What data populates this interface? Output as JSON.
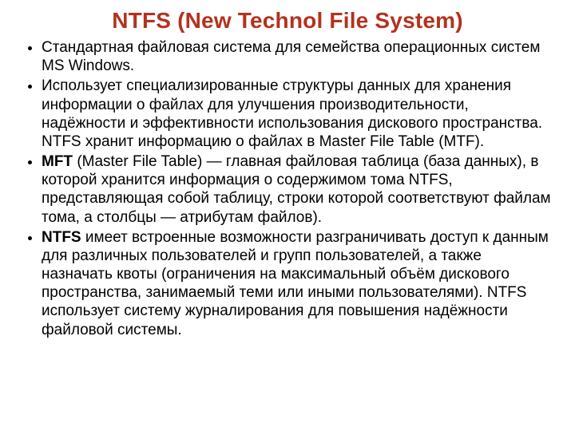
{
  "title": "NTFS (New Technol File System)",
  "bullets": [
    {
      "lead": "",
      "text": "Стандартная файловая система для семейства операционных систем MS Windows."
    },
    {
      "lead": "",
      "text": "Использует специализированные структуры данных для хранения информации о файлах для улучшения производительности, надёжности и эффективности использования дискового пространства. NTFS хранит информацию о файлах в Master File Table (MTF)."
    },
    {
      "lead": "MFT",
      "text": " (Master File Table) — главная файловая таблица (база данных), в которой хранится информация о содержимом тома NTFS, представляющая собой таблицу, строки которой соответствуют файлам тома, а столбцы — атрибутам файлов)."
    },
    {
      "lead": "NTFS",
      "text": " имеет встроенные возможности разграничивать доступ к данным для различных пользователей и групп пользователей, а также назначать квоты (ограничения на максимальный объём дискового пространства, занимаемый теми или иными пользователями). NTFS использует систему журналирования для повышения надёжности файловой системы."
    }
  ]
}
